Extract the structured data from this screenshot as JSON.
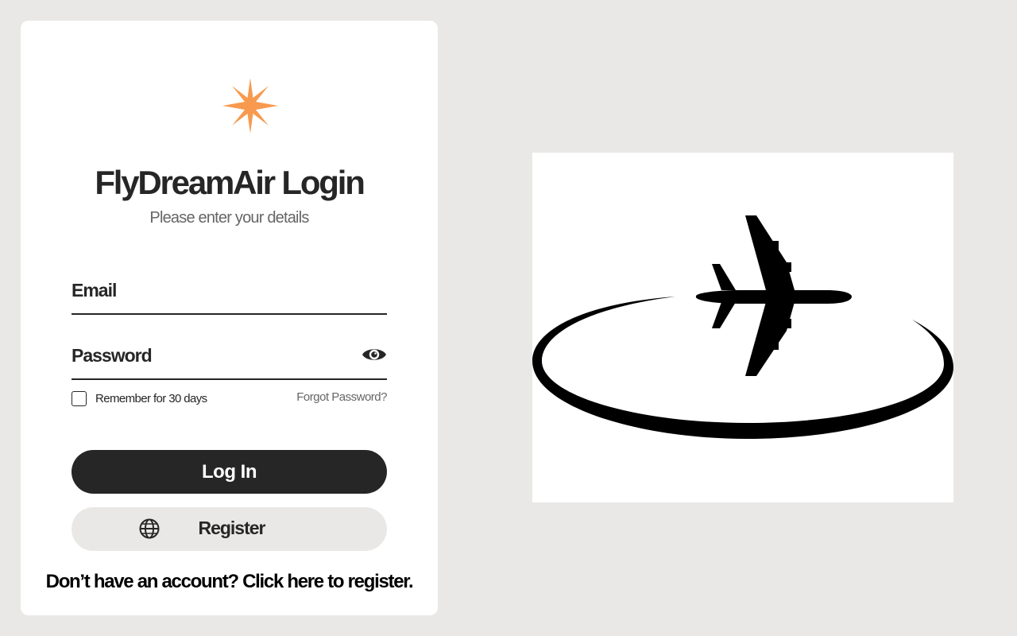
{
  "app": {
    "title": "FlyDreamAir Login",
    "subtitle": "Please enter your details",
    "brand_icon": "sparkle-star",
    "accent_color": "#f79a4f"
  },
  "form": {
    "email_label": "Email",
    "password_label": "Password",
    "password_toggle_icon": "eye-icon",
    "remember_label": "Remember for 30 days",
    "remember_checked": false,
    "forgot_label": "Forgot Password?"
  },
  "actions": {
    "login_label": "Log In",
    "login_color": "#262626",
    "register_label": "Register",
    "register_icon": "globe-icon",
    "footer_text": "Don’t have an account? Click here to register."
  },
  "hero": {
    "illustration": "airplane-orbit-icon"
  }
}
